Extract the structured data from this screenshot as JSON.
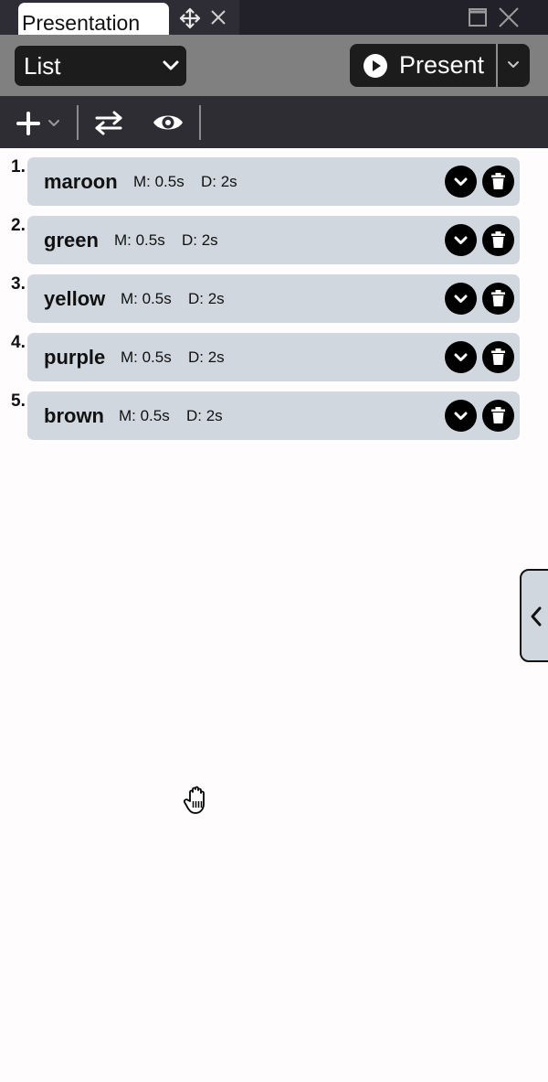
{
  "tab": {
    "title": "Presentation"
  },
  "header": {
    "mode_value": "List",
    "present_label": "Present"
  },
  "toolbar": {
    "icons": [
      "plus-icon",
      "chevron-down-icon",
      "swap-arrows-icon",
      "eye-icon"
    ]
  },
  "slides": [
    {
      "number": "1.",
      "name": "maroon",
      "motion": "M: 0.5s",
      "duration": "D: 2s"
    },
    {
      "number": "2.",
      "name": "green",
      "motion": "M: 0.5s",
      "duration": "D: 2s"
    },
    {
      "number": "3.",
      "name": "yellow",
      "motion": "M: 0.5s",
      "duration": "D: 2s"
    },
    {
      "number": "4.",
      "name": "purple",
      "motion": "M: 0.5s",
      "duration": "D: 2s"
    },
    {
      "number": "5.",
      "name": "brown",
      "motion": "M: 0.5s",
      "duration": "D: 2s"
    }
  ],
  "colors": {
    "tabbar_bg": "#22212a",
    "header_bg": "#808080",
    "toolbar_bg": "#2e2d33",
    "card_bg": "#d0d7df",
    "button_bg": "#1c1c1c"
  }
}
